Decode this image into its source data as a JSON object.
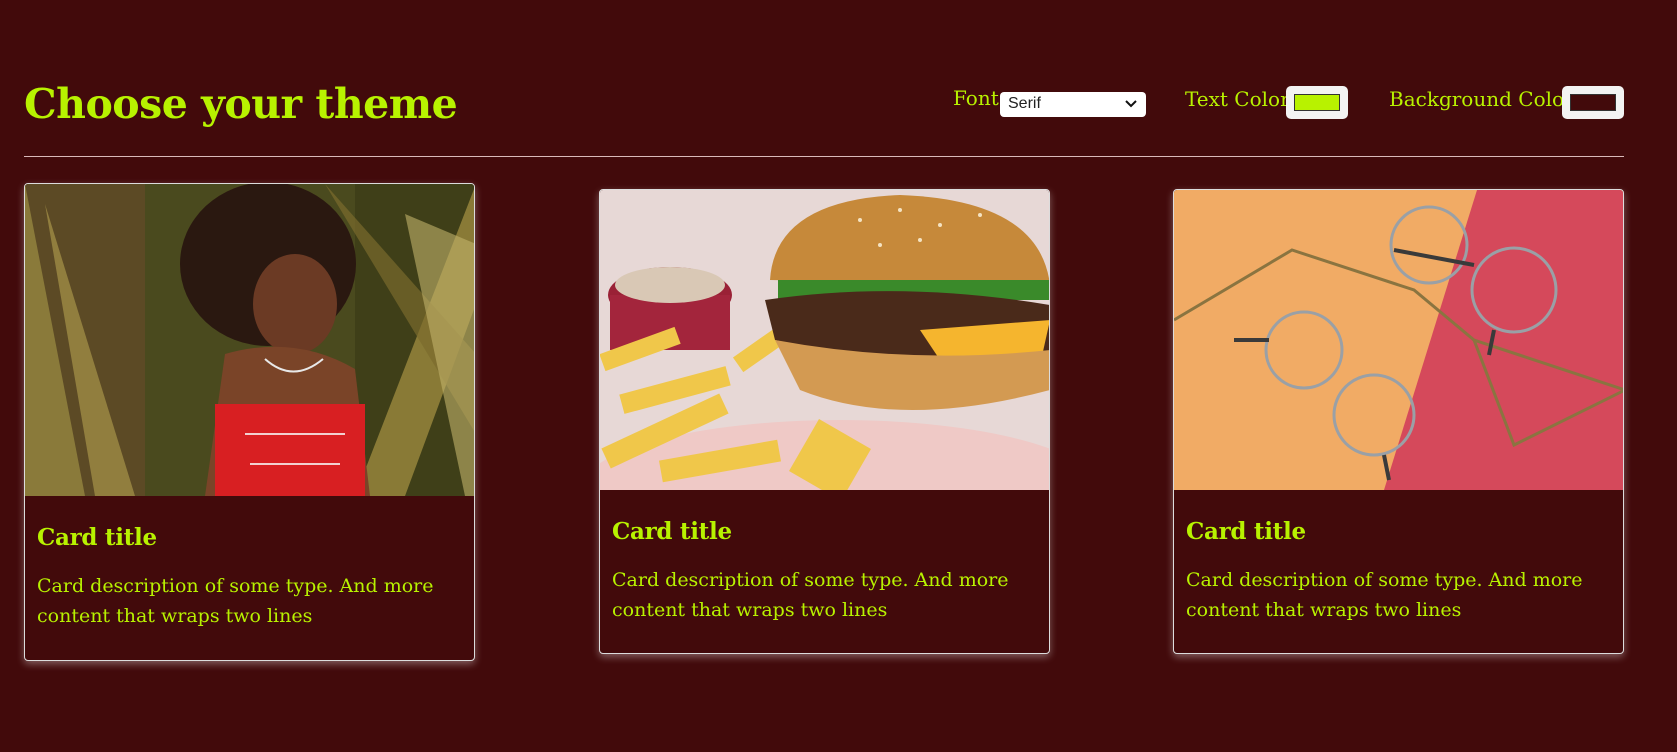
{
  "page": {
    "title": "Choose your theme",
    "background_color": "#420a0b",
    "text_color": "#b8f200"
  },
  "controls": {
    "font_label": "Font",
    "font_value": "Serif",
    "text_color_label": "Text Color",
    "text_color_value": "#b8f200",
    "bg_color_label": "Background Color",
    "bg_color_value": "#420a0b"
  },
  "cards": [
    {
      "title": "Card title",
      "description": "Card description of some type. And more content that wraps two lines",
      "image": "woman-smiling-under-palm-leaves"
    },
    {
      "title": "Card title",
      "description": "Card description of some type. And more content that wraps two lines",
      "image": "cheeseburger-with-fries"
    },
    {
      "title": "Card title",
      "description": "Card description of some type. And more content that wraps two lines",
      "image": "eyeglasses-on-orange-and-red"
    }
  ]
}
